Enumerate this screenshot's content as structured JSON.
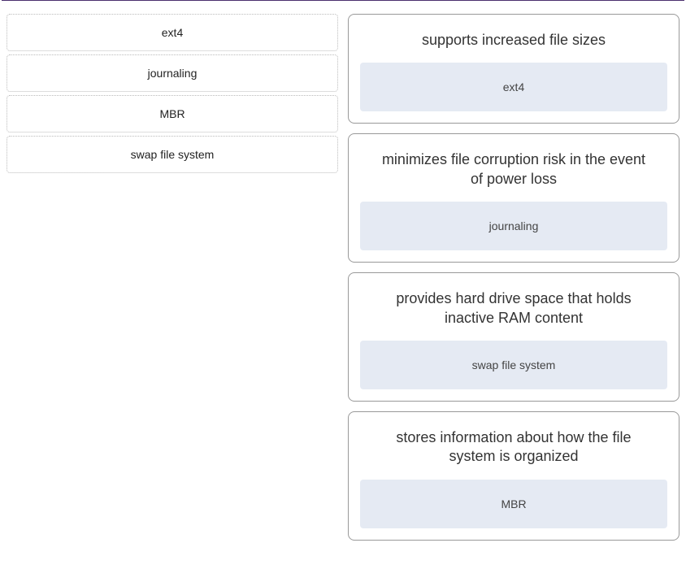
{
  "sourceItems": [
    {
      "label": "ext4"
    },
    {
      "label": "journaling"
    },
    {
      "label": "MBR"
    },
    {
      "label": "swap file system"
    }
  ],
  "targets": [
    {
      "description": "supports increased file sizes",
      "answer": "ext4"
    },
    {
      "description": "minimizes file corruption risk in the event of power loss",
      "answer": "journaling"
    },
    {
      "description": "provides hard drive space that holds inactive RAM content",
      "answer": "swap file system"
    },
    {
      "description": "stores information about how the file system is organized",
      "answer": "MBR"
    }
  ]
}
